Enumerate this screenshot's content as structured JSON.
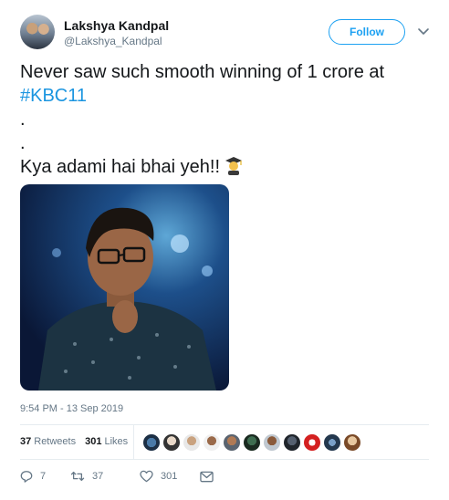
{
  "author": {
    "name": "Lakshya Kandpal",
    "handle": "@Lakshya_Kandpal"
  },
  "follow_label": "Follow",
  "tweet": {
    "line1": "Never saw such smooth winning of 1 crore at",
    "hashtag": "#KBC11",
    "line3": ".",
    "line4": ".",
    "line5": "Kya adami hai bhai yeh!!",
    "emoji": "man-student-emoji"
  },
  "timestamp": "9:54 PM - 13 Sep 2019",
  "stats": {
    "retweets_count": "37",
    "retweets_label": "Retweets",
    "likes_count": "301",
    "likes_label": "Likes"
  },
  "actions": {
    "replies": "7",
    "retweets": "37",
    "likes": "301"
  },
  "colors": {
    "accent": "#1da1f2",
    "hashtag": "#1b95e0",
    "muted": "#657786",
    "text": "#14171a"
  }
}
